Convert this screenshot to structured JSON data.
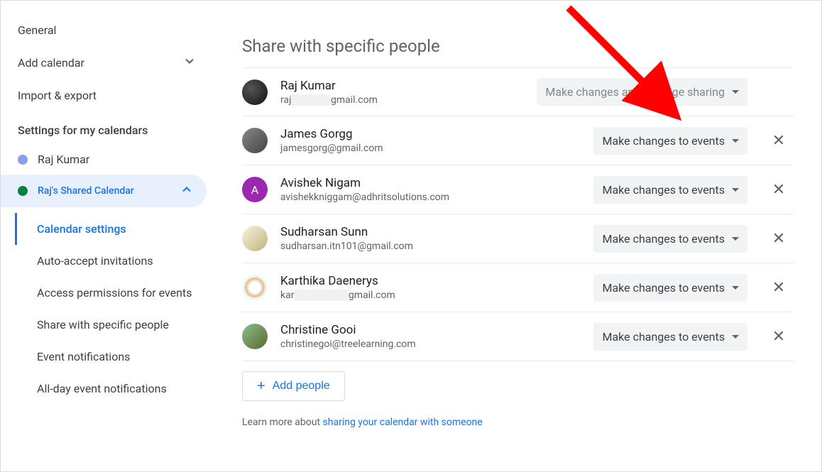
{
  "sidebar": {
    "general": "General",
    "addCalendar": "Add calendar",
    "importExport": "Import & export",
    "settingsHeading": "Settings for my calendars",
    "calendars": [
      {
        "name": "Raj Kumar",
        "color": "#8e9ee6"
      },
      {
        "name": "Raj's Shared Calendar",
        "color": "#0b8043"
      }
    ],
    "subItems": [
      "Calendar settings",
      "Auto-accept invitations",
      "Access permissions for events",
      "Share with specific people",
      "Event notifications",
      "All-day event notifications"
    ]
  },
  "main": {
    "heading": "Share with specific people",
    "people": [
      {
        "name": "Raj Kumar",
        "emailPrefix": "raj",
        "emailSuffix": "gmail.com",
        "redacted": true,
        "permission": "Make changes and manage sharing",
        "removable": false,
        "avatarClass": "av-dark",
        "letter": ""
      },
      {
        "name": "James Gorgg",
        "email": "jamesgorg@gmail.com",
        "permission": "Make changes to events",
        "removable": true,
        "avatarClass": "av-gray",
        "letter": ""
      },
      {
        "name": "Avishek Nigam",
        "email": "avishekkniggam@adhritsolutions.com",
        "permission": "Make changes to events",
        "removable": true,
        "avatarClass": "av-purple",
        "letter": "A"
      },
      {
        "name": "Sudharsan Sunn",
        "email": "sudharsan.itn101@gmail.com",
        "permission": "Make changes to events",
        "removable": true,
        "avatarClass": "av-photo1",
        "letter": ""
      },
      {
        "name": "Karthika Daenerys",
        "emailPrefix": "kar",
        "emailSuffix": "gmail.com",
        "redacted": true,
        "permission": "Make changes to events",
        "removable": true,
        "avatarClass": "av-photo2",
        "letter": ""
      },
      {
        "name": "Christine Gooi",
        "email": "christinegoi@treelearning.com",
        "permission": "Make changes to events",
        "removable": true,
        "avatarClass": "av-photo3",
        "letter": ""
      }
    ],
    "addPeople": "Add people",
    "learnMorePrefix": "Learn more about ",
    "learnMoreLink": "sharing your calendar with someone"
  }
}
